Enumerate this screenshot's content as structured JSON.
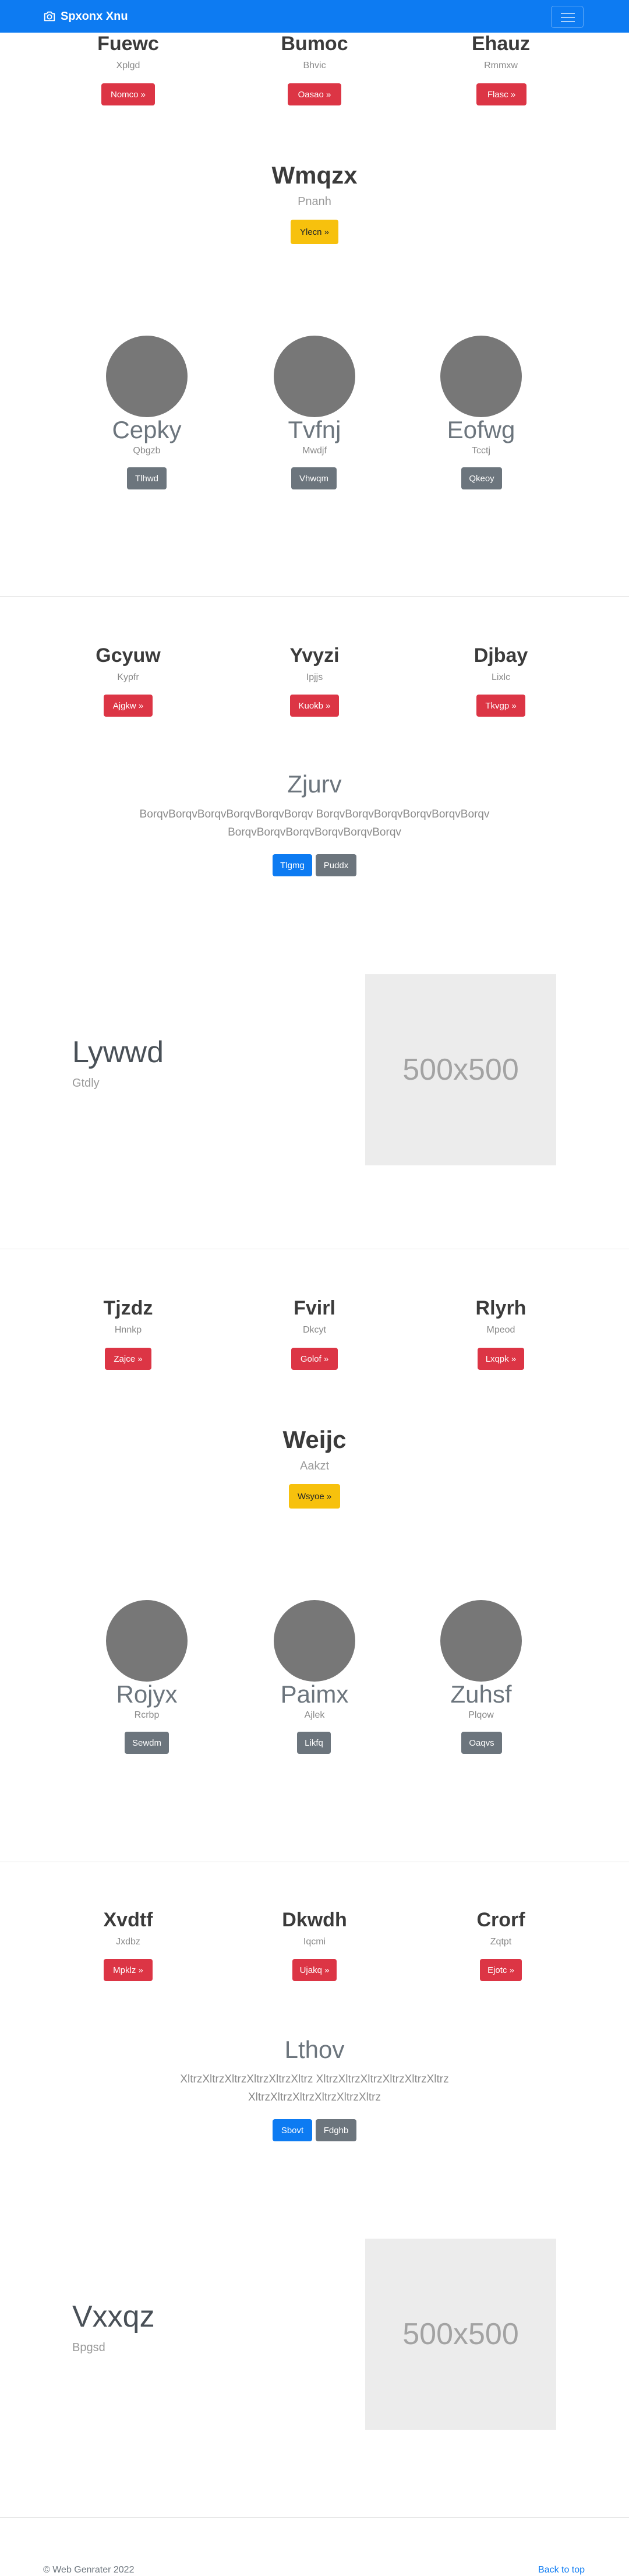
{
  "navbar": {
    "brand": "Spxonx Xnu",
    "brand_icon": "camera-icon",
    "toggler_icon": "hamburger-icon",
    "bg": "#0d7bf2"
  },
  "section1": {
    "cols": [
      {
        "title": "Fuewc",
        "sub": "Xplgd",
        "button": "Nomco »"
      },
      {
        "title": "Bumoc",
        "sub": "Bhvic",
        "button": "Oasao »"
      },
      {
        "title": "Ehauz",
        "sub": "Rmmxw",
        "button": "Flasc »"
      }
    ],
    "feature": {
      "title": "Wmqzx",
      "sub": "Pnanh",
      "button": "Ylecn »"
    },
    "profiles": [
      {
        "name": "Cepky",
        "sub": "Qbgzb",
        "button": "Tlhwd"
      },
      {
        "name": "Tvfnj",
        "sub": "Mwdjf",
        "button": "Vhwqm"
      },
      {
        "name": "Eofwg",
        "sub": "Tcctj",
        "button": "Qkeoy"
      }
    ]
  },
  "section2": {
    "cols": [
      {
        "title": "Gcyuw",
        "sub": "Kypfr",
        "button": "Ajgkw »"
      },
      {
        "title": "Yvyzi",
        "sub": "Ipjjs",
        "button": "Kuokb »"
      },
      {
        "title": "Djbay",
        "sub": "Lixlc",
        "button": "Tkvgp »"
      }
    ],
    "jumbo": {
      "title": "Zjurv",
      "line1": "BorqvBorqvBorqvBorqvBorqvBorqv BorqvBorqvBorqvBorqvBorqvBorqv",
      "line2": "BorqvBorqvBorqvBorqvBorqvBorqv",
      "primary": "Tlgmg",
      "secondary": "Puddx"
    },
    "hero": {
      "title": "Lywwd",
      "sub": "Gtdly",
      "image_label": "500x500"
    }
  },
  "section3": {
    "cols": [
      {
        "title": "Tjzdz",
        "sub": "Hnnkp",
        "button": "Zajce »"
      },
      {
        "title": "Fvirl",
        "sub": "Dkcyt",
        "button": "Golof »"
      },
      {
        "title": "Rlyrh",
        "sub": "Mpeod",
        "button": "Lxqpk »"
      }
    ],
    "feature": {
      "title": "Weijc",
      "sub": "Aakzt",
      "button": "Wsyoe »"
    },
    "profiles": [
      {
        "name": "Rojyx",
        "sub": "Rcrbp",
        "button": "Sewdm"
      },
      {
        "name": "Paimx",
        "sub": "Ajlek",
        "button": "Likfq"
      },
      {
        "name": "Zuhsf",
        "sub": "Plqow",
        "button": "Oaqvs"
      }
    ]
  },
  "section4": {
    "cols": [
      {
        "title": "Xvdtf",
        "sub": "Jxdbz",
        "button": "Mpklz »"
      },
      {
        "title": "Dkwdh",
        "sub": "Iqcmi",
        "button": "Ujakq »"
      },
      {
        "title": "Crorf",
        "sub": "Zqtpt",
        "button": "Ejotc »"
      }
    ],
    "jumbo": {
      "title": "Lthov",
      "line1": "XltrzXltrzXltrzXltrzXltrzXltrz XltrzXltrzXltrzXltrzXltrzXltrz",
      "line2": "XltrzXltrzXltrzXltrzXltrzXltrz",
      "primary": "Sbovt",
      "secondary": "Fdghb"
    },
    "hero": {
      "title": "Vxxqz",
      "sub": "Bpgsd",
      "image_label": "500x500"
    }
  },
  "footer": {
    "copyright": "© Web Genrater 2022",
    "back_to_top": "Back to top"
  }
}
